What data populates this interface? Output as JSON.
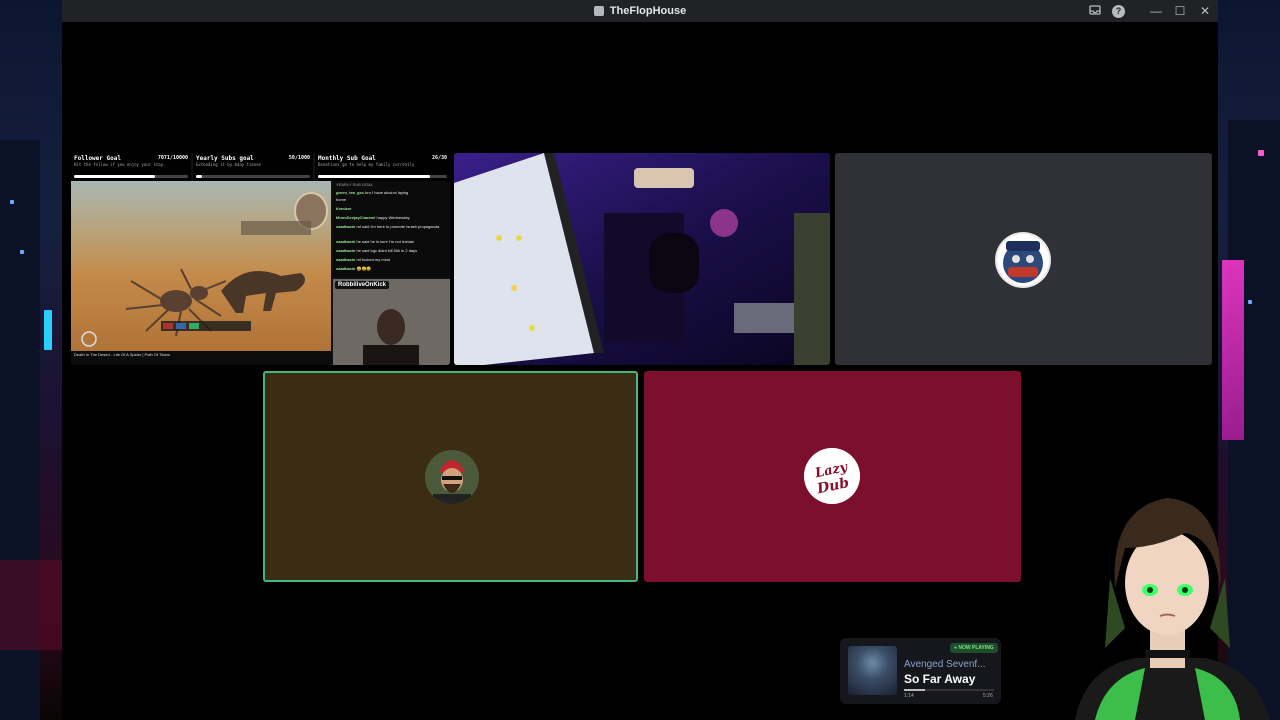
{
  "window": {
    "title": "TheFlopHouse",
    "inbox_icon": "inbox-icon",
    "help_icon": "help-icon",
    "help_glyph": "?",
    "minimize_glyph": "—",
    "maximize_glyph": "☐",
    "close_glyph": "✕"
  },
  "stream": {
    "goals": [
      {
        "title": "Follower Goal",
        "count": "7071/10000",
        "desc": "Hit the follow if you enjoy your stay.",
        "progress": 0.71
      },
      {
        "title": "Yearly Subs goal",
        "count": "50/1000",
        "desc": "Extending it by bday tienes",
        "progress": 0.05
      },
      {
        "title": "Monthly Sub Goal",
        "count": "26/30",
        "desc": "Donations go to help my family currently",
        "progress": 0.87
      }
    ],
    "chat_header": "YEARLY SUB GOAL",
    "chat": [
      {
        "name": "green_tea_gcc",
        "msg": "bro I have alcohol laying"
      },
      {
        "name": "",
        "msg": "home"
      },
      {
        "name": "Kemizer",
        "msg": ""
      },
      {
        "name": "MunoDeejayChannel",
        "msg": "happy Wednesday."
      },
      {
        "name": "saadbazin",
        "msg": "mf said I'm here to promote Israeli propaganda"
      },
      {
        "name": "saadbazin",
        "msg": "he said he is sure I'm not Iranian"
      },
      {
        "name": "saadbazin",
        "msg": "he said bgc didnt kill 50k in 2 days"
      },
      {
        "name": "saadbazin",
        "msg": "mf fucked my mind"
      },
      {
        "name": "saadbazin",
        "msg": "😄😄😄"
      }
    ],
    "cam_label": "RobbiliveOnKick",
    "game_title": "Death In The Desert - Life Of A Spider | Path Of Titans"
  },
  "tiles": {
    "user1_avatar": "Vipers Guild",
    "user3_avatar": "Lazy Dub"
  },
  "now_playing": {
    "badge": "● NOW PLAYING",
    "artist": "Avenged Sevenf...",
    "song": "So Far Away",
    "elapsed": "1:14",
    "total": "5:26",
    "progress": 0.23
  },
  "colors": {
    "titlebar": "#202225",
    "tile_grey": "#2f3136",
    "tile_brown": "#3a2d14",
    "tile_red": "#7c0f2e",
    "speaking_border": "#43b581"
  }
}
